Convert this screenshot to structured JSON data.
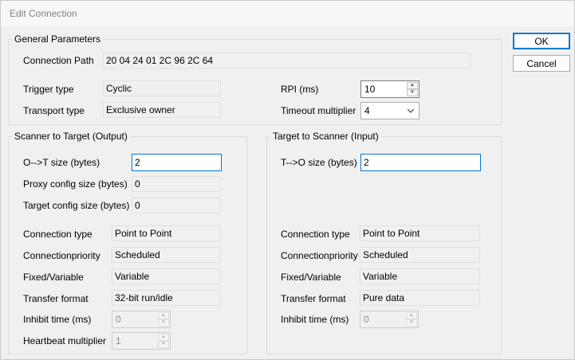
{
  "window": {
    "title": "Edit Connection"
  },
  "buttons": {
    "ok": "OK",
    "cancel": "Cancel"
  },
  "general": {
    "title": "General Parameters",
    "connection_path_label": "Connection Path",
    "connection_path_value": "20 04 24 01 2C 96 2C 64",
    "trigger_type_label": "Trigger type",
    "trigger_type_value": "Cyclic",
    "transport_type_label": "Transport type",
    "transport_type_value": "Exclusive owner",
    "rpi_label": "RPI (ms)",
    "rpi_value": "10",
    "timeout_label": "Timeout multiplier",
    "timeout_value": "4"
  },
  "output": {
    "title": "Scanner to Target (Output)",
    "ot_size_label": "O-->T size (bytes)",
    "ot_size_value": "2",
    "proxy_label": "Proxy config size (bytes)",
    "proxy_value": "0",
    "target_config_label": "Target config size (bytes)",
    "target_config_value": "0",
    "conn_type_label": "Connection type",
    "conn_type_value": "Point to Point",
    "priority_label": "Connectionpriority",
    "priority_value": "Scheduled",
    "fixed_label": "Fixed/Variable",
    "fixed_value": "Variable",
    "transfer_label": "Transfer format",
    "transfer_value": "32-bit run/idle",
    "inhibit_label": "Inhibit time (ms)",
    "inhibit_value": "0",
    "heartbeat_label": "Heartbeat multiplier",
    "heartbeat_value": "1"
  },
  "input": {
    "title": "Target to Scanner (Input)",
    "to_size_label": "T-->O size (bytes)",
    "to_size_value": "2",
    "conn_type_label": "Connection type",
    "conn_type_value": "Point to Point",
    "priority_label": "Connectionpriority",
    "priority_value": "Scheduled",
    "fixed_label": "Fixed/Variable",
    "fixed_value": "Variable",
    "transfer_label": "Transfer format",
    "transfer_value": "Pure data",
    "inhibit_label": "Inhibit time (ms)",
    "inhibit_value": "0"
  },
  "icons": {
    "spin_up": "spin-up-arrow-icon",
    "spin_down": "spin-down-arrow-icon",
    "dropdown": "chevron-down-icon"
  },
  "colors": {
    "focus_border": "#0078d7",
    "window_bg": "#f0f0f0"
  }
}
